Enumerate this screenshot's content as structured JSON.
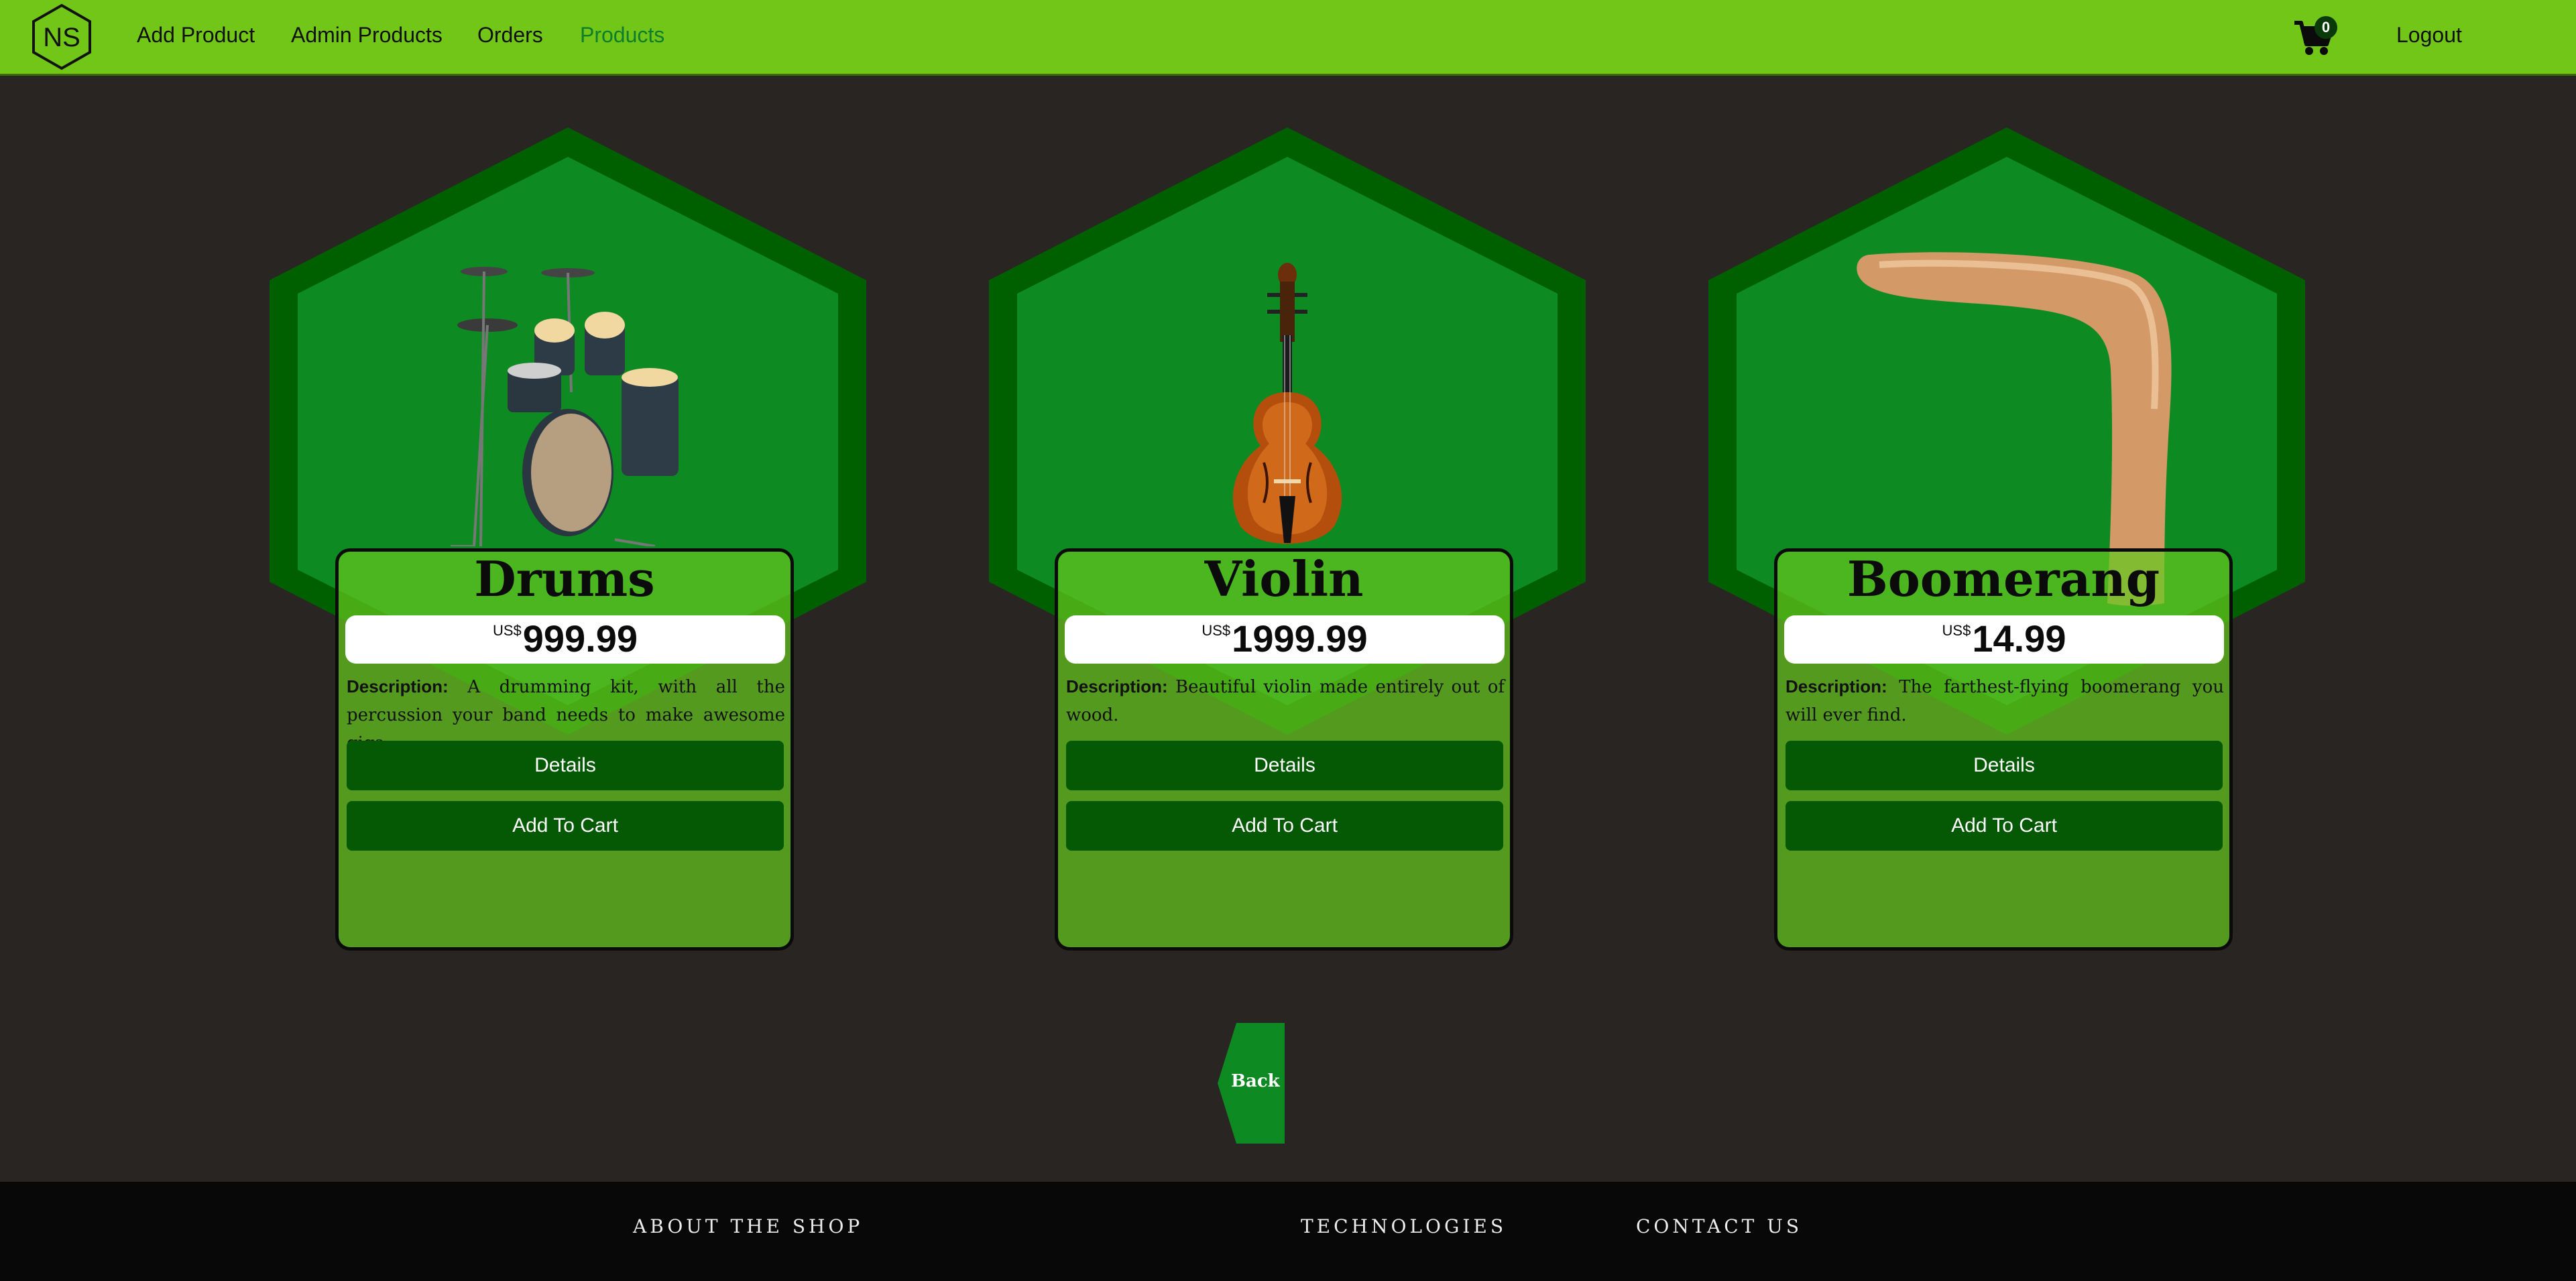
{
  "nav": {
    "logo_text": "NS",
    "links": [
      "Add Product",
      "Admin Products",
      "Orders",
      "Products"
    ],
    "active": "Products",
    "cart_count": "0",
    "logout": "Logout"
  },
  "colors": {
    "nav_bg": "#72c618",
    "page_bg": "#292523",
    "hex_outer": "#006000",
    "hex_inner": "#0e8a22",
    "card_bg": "#5cb81d",
    "button_bg": "#055905",
    "footer_bg": "#080808"
  },
  "products": [
    {
      "title": "Drums",
      "currency": "US$",
      "price": "999.99",
      "desc_label": "Description:",
      "description": "A drumming kit, with all the percussion your band needs to make awesome gigs.",
      "details_label": "Details",
      "cart_label": "Add To Cart",
      "image": "drum-kit"
    },
    {
      "title": "Violin",
      "currency": "US$",
      "price": "1999.99",
      "desc_label": "Description:",
      "description": "Beautiful violin made entirely out of wood.",
      "details_label": "Details",
      "cart_label": "Add To Cart",
      "image": "violin"
    },
    {
      "title": "Boomerang",
      "currency": "US$",
      "price": "14.99",
      "desc_label": "Description:",
      "description": "The farthest-flying boomerang you will ever find.",
      "details_label": "Details",
      "cart_label": "Add To Cart",
      "image": "boomerang"
    }
  ],
  "back_label": "Back",
  "footer": {
    "links": [
      "ABOUT THE SHOP",
      "TECHNOLOGIES",
      "CONTACT US"
    ]
  }
}
